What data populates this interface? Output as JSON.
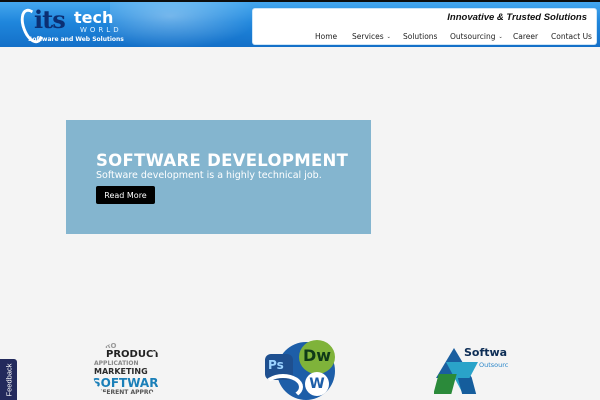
{
  "header": {
    "logo": {
      "brand_its": "its",
      "brand_tech": "tech",
      "brand_world": "WORLD",
      "tagline": "Software and Web Solutions"
    },
    "slogan": "Innovative & Trusted Solutions",
    "nav": [
      {
        "label": "Home",
        "has_dropdown": false
      },
      {
        "label": "Services",
        "has_dropdown": true
      },
      {
        "label": "Solutions",
        "has_dropdown": false
      },
      {
        "label": "Outsourcing",
        "has_dropdown": true
      },
      {
        "label": "Career",
        "has_dropdown": false
      },
      {
        "label": "Contact Us",
        "has_dropdown": false
      }
    ],
    "dropdown_caret": "⌄"
  },
  "hero": {
    "title": "SOFTWARE DEVELOPMENT",
    "subtitle": "Software development is a highly technical job.",
    "button_label": "Read More"
  },
  "tiles": {
    "software": {
      "words": [
        "PRO",
        "PRODUCT",
        "APPLICATION",
        "MARKETING",
        "SOFTWAR",
        "IFFERENT APPROAC"
      ]
    },
    "web": {
      "ps": "Ps",
      "dw": "Dw",
      "wp": "W"
    },
    "outsourcing": {
      "word": "Softwa",
      "sub": "Outsourc"
    }
  },
  "feedback": {
    "label": "Feedback"
  },
  "colors": {
    "header_blue": "#1f86dc",
    "hero_bg": "#84b5cf",
    "button_bg": "#000000",
    "feedback_bg": "#232a5c"
  }
}
